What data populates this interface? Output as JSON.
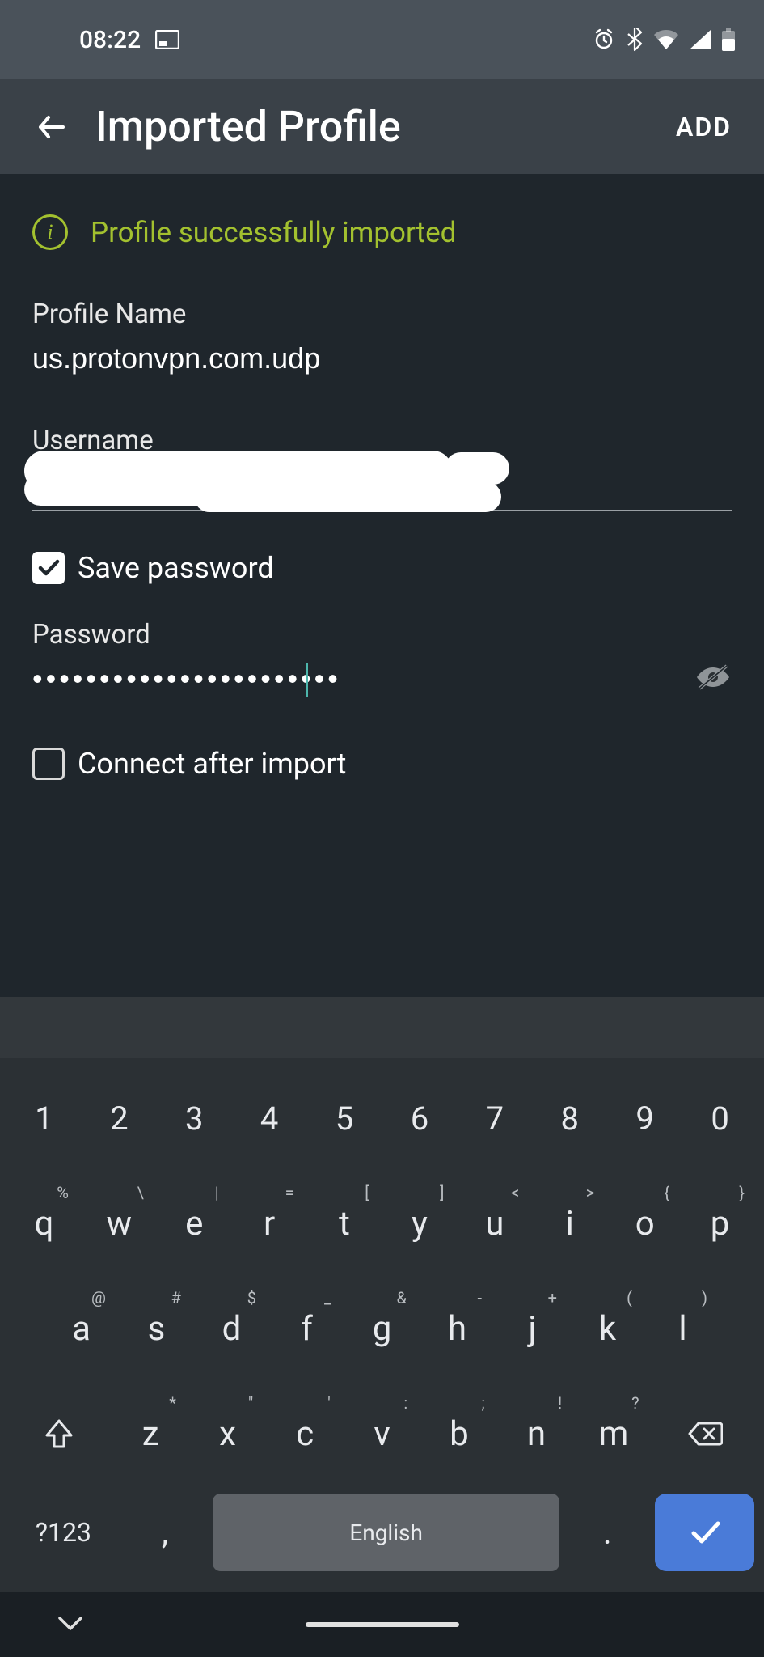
{
  "status": {
    "time": "08:22",
    "icons": [
      "cast-icon",
      "alarm-icon",
      "bluetooth-icon",
      "wifi-icon",
      "signal-icon",
      "battery-icon"
    ]
  },
  "header": {
    "title": "Imported Profile",
    "action": "ADD"
  },
  "banner": {
    "message": "Profile successfully imported"
  },
  "fields": {
    "profile_name_label": "Profile Name",
    "profile_name_value": "us.protonvpn.com.udp",
    "username_label": "Username",
    "username_value": "",
    "save_password_label": "Save password",
    "save_password_checked": true,
    "password_label": "Password",
    "password_value": "•••••••••••••••••••••••",
    "connect_after_label": "Connect after import",
    "connect_after_checked": false
  },
  "keyboard": {
    "row_num": [
      "1",
      "2",
      "3",
      "4",
      "5",
      "6",
      "7",
      "8",
      "9",
      "0"
    ],
    "row1": [
      {
        "m": "q",
        "s": "%"
      },
      {
        "m": "w",
        "s": "\\"
      },
      {
        "m": "e",
        "s": "|"
      },
      {
        "m": "r",
        "s": "="
      },
      {
        "m": "t",
        "s": "["
      },
      {
        "m": "y",
        "s": "]"
      },
      {
        "m": "u",
        "s": "<"
      },
      {
        "m": "i",
        "s": ">"
      },
      {
        "m": "o",
        "s": "{"
      },
      {
        "m": "p",
        "s": "}"
      }
    ],
    "row2": [
      {
        "m": "a",
        "s": "@"
      },
      {
        "m": "s",
        "s": "#"
      },
      {
        "m": "d",
        "s": "$"
      },
      {
        "m": "f",
        "s": "_"
      },
      {
        "m": "g",
        "s": "&"
      },
      {
        "m": "h",
        "s": "-"
      },
      {
        "m": "j",
        "s": "+"
      },
      {
        "m": "k",
        "s": "("
      },
      {
        "m": "l",
        "s": ")"
      }
    ],
    "row3": [
      {
        "m": "z",
        "s": "*"
      },
      {
        "m": "x",
        "s": "\""
      },
      {
        "m": "c",
        "s": "'"
      },
      {
        "m": "v",
        "s": ":"
      },
      {
        "m": "b",
        "s": ";"
      },
      {
        "m": "n",
        "s": "!"
      },
      {
        "m": "m",
        "s": "?"
      }
    ],
    "symbols_key": "?123",
    "space_label": "English",
    "comma": ",",
    "period": "."
  }
}
